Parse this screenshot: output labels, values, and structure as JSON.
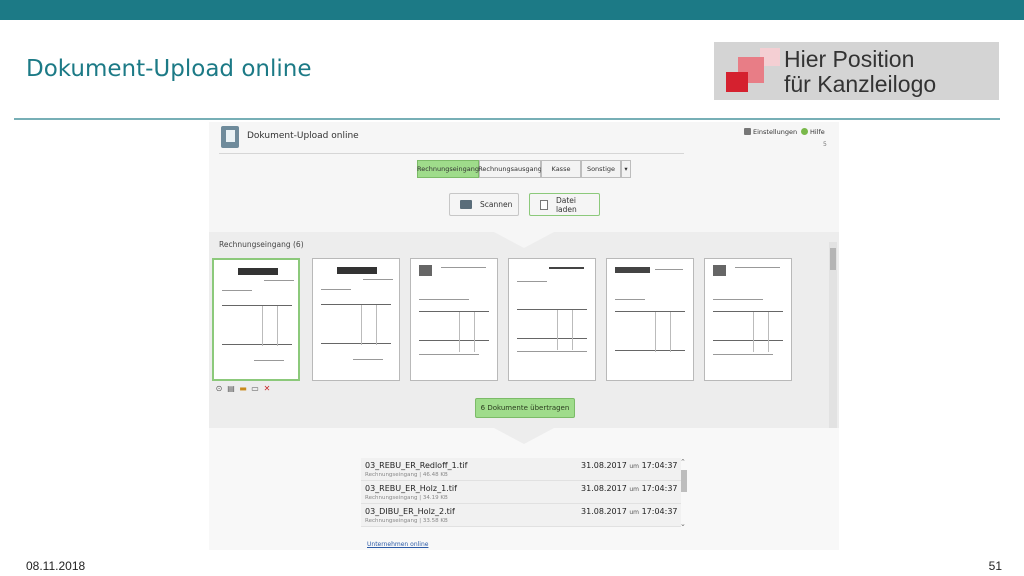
{
  "slide": {
    "title": "Dokument-Upload online",
    "logo_text_line1": "Hier Position",
    "logo_text_line2": "für Kanzleilogo",
    "date": "08.11.2018",
    "page": "51",
    "brand_color": "#1c7a86"
  },
  "app": {
    "title": "Dokument-Upload online",
    "settings_label": "Einstellungen",
    "help_label": "Hilfe",
    "header_small": "5",
    "tabs": [
      {
        "label": "Rechnungseingang",
        "active": true
      },
      {
        "label": "Rechnungsausgang",
        "active": false
      },
      {
        "label": "Kasse",
        "active": false
      },
      {
        "label": "Sonstige",
        "active": false
      },
      {
        "label": "▾",
        "active": false
      }
    ],
    "scan_button": "Scannen",
    "load_button": "Datei laden",
    "section_title": "Rechnungseingang (6)",
    "thumbnail_count": 6,
    "transfer_button": "6 Dokumente übertragen",
    "files": [
      {
        "name": "03_REBU_ER_Redloff_1.tif",
        "meta": "Rechnungseingang | 46.48 KB",
        "date": "31.08.2017",
        "um": "um",
        "time": "17:04:37"
      },
      {
        "name": "03_REBU_ER_Holz_1.tif",
        "meta": "Rechnungseingang | 34.19 KB",
        "date": "31.08.2017",
        "um": "um",
        "time": "17:04:37"
      },
      {
        "name": "03_DIBU_ER_Holz_2.tif",
        "meta": "Rechnungseingang | 33.58 KB",
        "date": "31.08.2017",
        "um": "um",
        "time": "17:04:37"
      }
    ],
    "company_link": "Unternehmen online",
    "accent_green": "#9fdc8b"
  }
}
